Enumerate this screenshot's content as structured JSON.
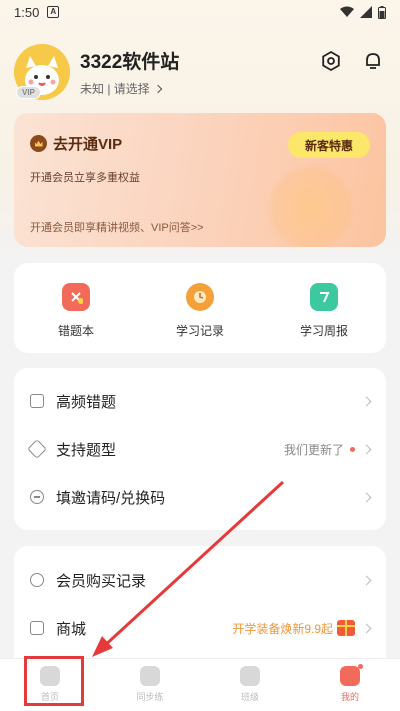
{
  "status_bar": {
    "time": "1:50",
    "notif_glyph": "A"
  },
  "profile": {
    "username": "3322软件站",
    "subtitle": "未知 | 请选择",
    "vip_badge": "VIP"
  },
  "header_icons": [
    "settings-icon",
    "bell-icon"
  ],
  "vip_card": {
    "title": "去开通VIP",
    "description": "开通会员立享多重权益",
    "button_label": "新客特惠",
    "footer": "开通会员即享精讲视频、VIP问答>>"
  },
  "tools": [
    {
      "label": "错题本",
      "icon": "wrong-questions-icon",
      "color": "#f26a5a"
    },
    {
      "label": "学习记录",
      "icon": "clock-icon",
      "color": "#f5a13a"
    },
    {
      "label": "学习周报",
      "icon": "weekly-report-icon",
      "color": "#3dc9a0"
    }
  ],
  "menu1": [
    {
      "label": "高频错题",
      "right": ""
    },
    {
      "label": "支持题型",
      "right": "我们更新了"
    },
    {
      "label": "填邀请码/兑换码",
      "right": ""
    }
  ],
  "menu2": [
    {
      "label": "会员购买记录",
      "right": ""
    },
    {
      "label": "商城",
      "right": "开学装备焕新9.9起"
    }
  ],
  "bottom_nav": [
    {
      "label": "首页"
    },
    {
      "label": "同步练"
    },
    {
      "label": "班级"
    },
    {
      "label": "我的"
    }
  ],
  "colors": {
    "accent": "#f26a5a",
    "annotation": "#e63a3a"
  }
}
